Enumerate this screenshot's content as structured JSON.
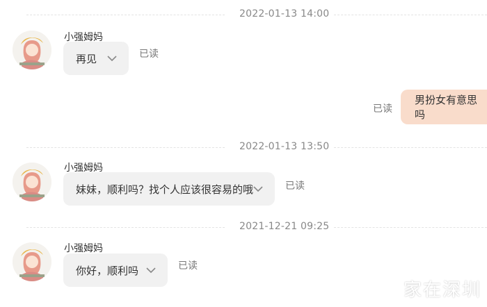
{
  "messages": [
    {
      "timestamp": "2022-01-13 14:00",
      "sender": "小强姆妈",
      "text": "再见",
      "status": "已读"
    },
    {
      "own_text": "男扮女有意思吗",
      "own_status": "已读"
    },
    {
      "timestamp": "2022-01-13 13:50",
      "sender": "小强姆妈",
      "text": "妹妹，顺利吗？找个人应该很容易的哦",
      "status": "已读"
    },
    {
      "timestamp": "2021-12-21 09:25",
      "sender": "小强姆妈",
      "text": "你好，顺利吗",
      "status": "已读"
    }
  ],
  "icons": {
    "chevron": "chevron-down-icon",
    "avatar": "avatar-illustration"
  },
  "colors": {
    "own_bubble": "#f9dccb",
    "other_bubble": "#f1f1f1",
    "divider": "#e3e3e3"
  },
  "watermark": "家在深圳"
}
